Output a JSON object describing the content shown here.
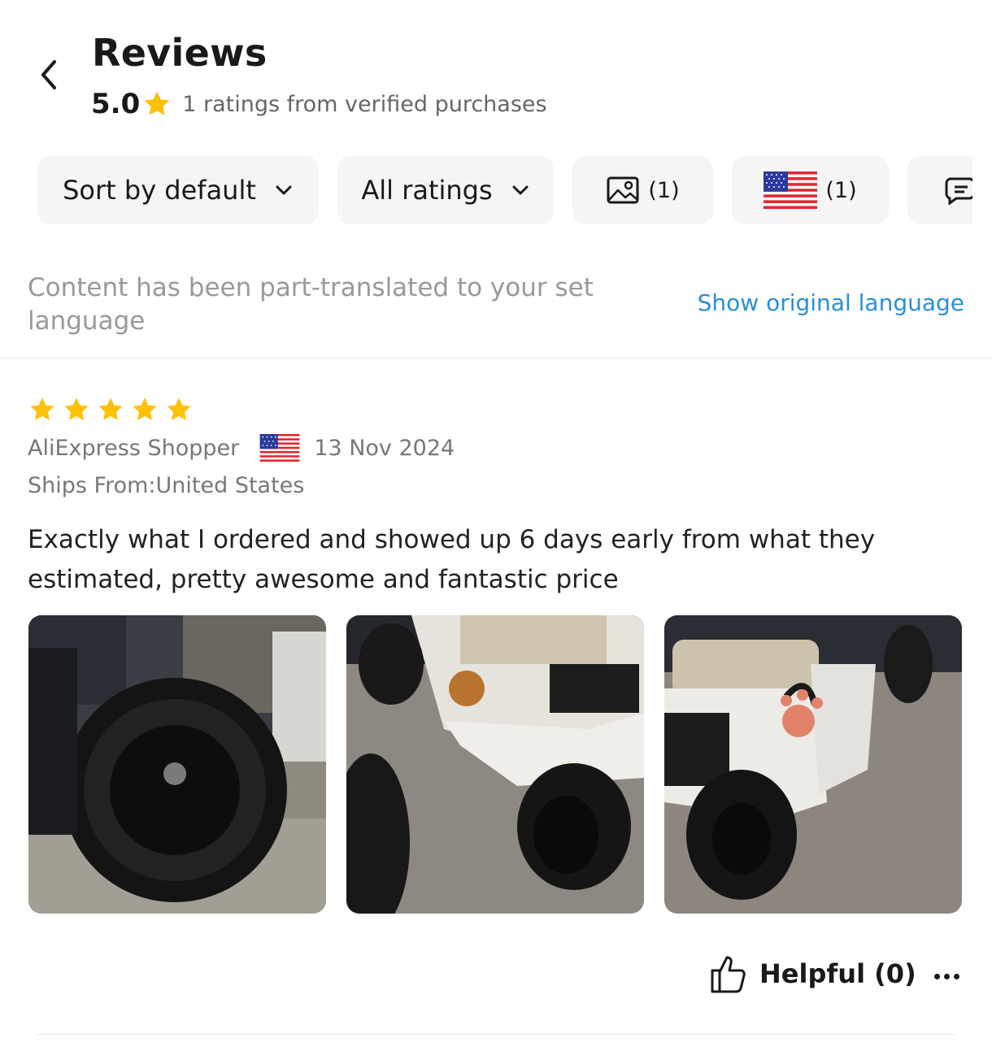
{
  "header": {
    "title": "Reviews",
    "rating_value": "5.0",
    "rating_summary": "1 ratings from verified purchases",
    "back_icon": "chevron-left-icon"
  },
  "filters": {
    "sort_label": "Sort by default",
    "ratings_label": "All ratings",
    "photos_count": "(1)",
    "country_count": "(1)",
    "photo_icon": "image-icon",
    "country_icon": "us-flag-icon",
    "extra_icon": "comment-icon"
  },
  "translation": {
    "notice": "Content has been part-translated to your set language",
    "show_original": "Show original language"
  },
  "review": {
    "stars": 5,
    "reviewer": "AliExpress Shopper",
    "date": "13 Nov 2024",
    "ships_from": "Ships From:United States",
    "text": "Exactly what I ordered and showed up 6 days early from what they estimated, pretty awesome and fantastic price",
    "photo_count": 3,
    "helpful_label": "Helpful (0)"
  },
  "colors": {
    "star": "#FFC107",
    "link": "#2A8FD6",
    "chip_bg": "#F5F5F5",
    "muted_text": "#999999"
  }
}
